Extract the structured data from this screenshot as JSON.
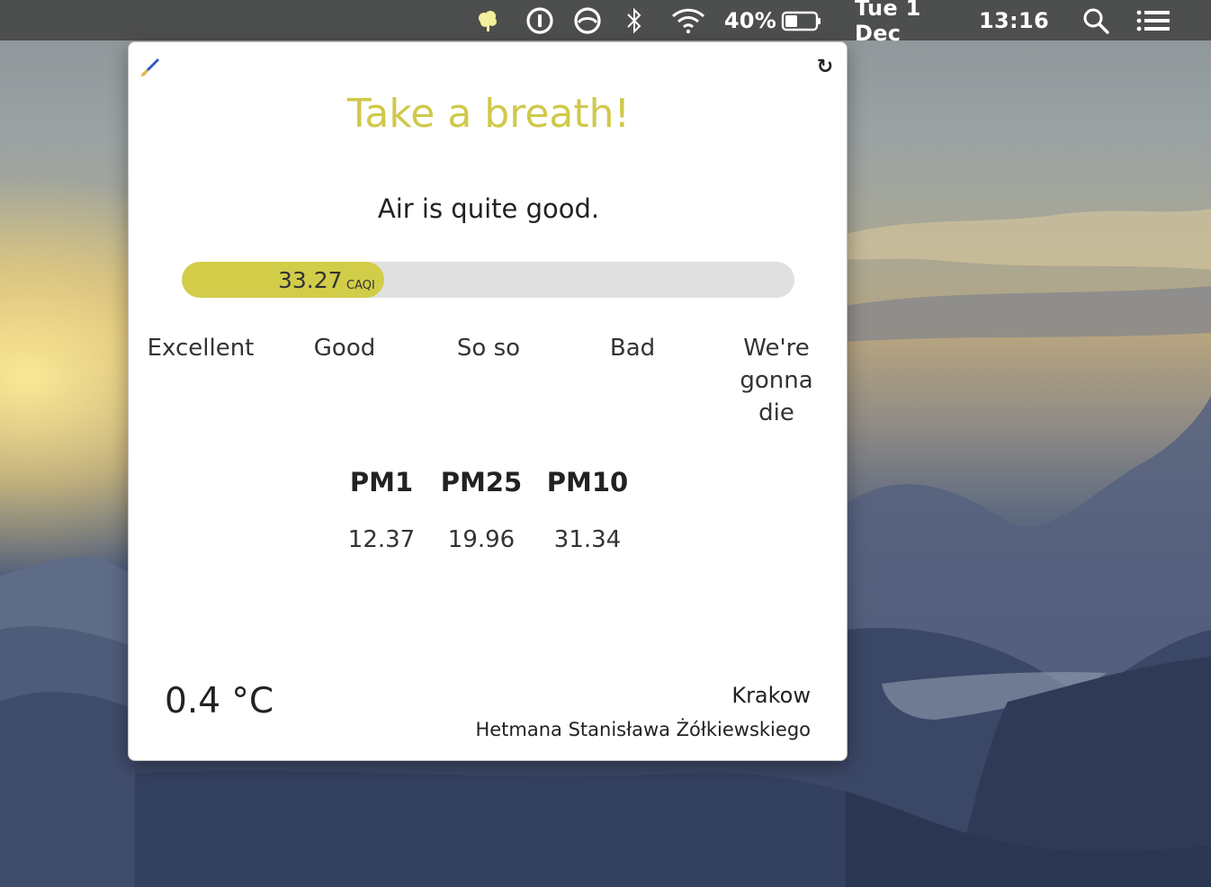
{
  "menubar": {
    "app_icon": "tree-icon",
    "icons": [
      "onepassword-icon",
      "backup-icon",
      "bluetooth-icon",
      "wifi-icon",
      "battery-icon",
      "spotlight-search-icon",
      "notification-center-icon"
    ],
    "battery_percent": "40%",
    "battery_level": 0.4,
    "date": "Tue 1 Dec",
    "time": "13:16"
  },
  "popup": {
    "edit_icon": "paintbrush-icon",
    "refresh_icon": "refresh-icon",
    "refresh_glyph": "↻",
    "title": "Take a breath!",
    "status": "Air is quite good.",
    "caqi": {
      "value": "33.27",
      "unit": "CAQI",
      "fill_fraction": 0.33
    },
    "scale": [
      {
        "label": "Excellent"
      },
      {
        "label": "Good"
      },
      {
        "label": "So so"
      },
      {
        "label": "Bad"
      },
      {
        "label": "We're gonna die"
      }
    ],
    "pollutants": [
      {
        "name": "PM1",
        "value": "12.37"
      },
      {
        "name": "PM25",
        "value": "19.96"
      },
      {
        "name": "PM10",
        "value": "31.34"
      }
    ],
    "temperature": "0.4 °C",
    "city": "Krakow",
    "street": "Hetmana Stanisława Żółkiewskiego"
  },
  "colors": {
    "accent": "#cfc94a",
    "bar_fill": "#d2cd48",
    "bar_track": "#e0e0e0"
  }
}
